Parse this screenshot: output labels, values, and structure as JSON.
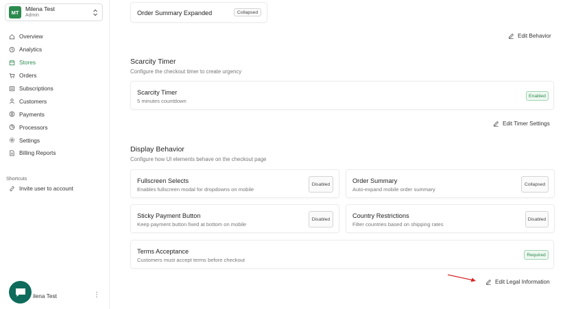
{
  "account": {
    "initials": "MT",
    "name": "Milena Test",
    "role": "Admin"
  },
  "nav": [
    {
      "label": "Overview",
      "icon": "home-icon",
      "active": false
    },
    {
      "label": "Analytics",
      "icon": "clock-icon",
      "active": false
    },
    {
      "label": "Stores",
      "icon": "store-icon",
      "active": true
    },
    {
      "label": "Orders",
      "icon": "cart-icon",
      "active": false
    },
    {
      "label": "Subscriptions",
      "icon": "list-icon",
      "active": false
    },
    {
      "label": "Customers",
      "icon": "user-icon",
      "active": false
    },
    {
      "label": "Payments",
      "icon": "dollar-icon",
      "active": false
    },
    {
      "label": "Processors",
      "icon": "pie-icon",
      "active": false
    },
    {
      "label": "Settings",
      "icon": "gear-icon",
      "active": false
    },
    {
      "label": "Billing Reports",
      "icon": "file-icon",
      "active": false
    }
  ],
  "shortcuts": {
    "title": "Shortcuts",
    "items": [
      {
        "label": "Invite user to account",
        "icon": "link-icon"
      }
    ]
  },
  "footer_user": {
    "name": "ilena Test"
  },
  "order_summary_card": {
    "title": "Order Summary Expanded",
    "badge": "Collapsed"
  },
  "edit_behavior": {
    "label": "Edit Behavior"
  },
  "scarcity": {
    "title": "Scarcity Timer",
    "subtitle": "Configure the checkout timer to create urgency",
    "card_title": "Scarcity Timer",
    "card_sub": "5 minutes countdown",
    "badge": "Enabled",
    "edit_label": "Edit Timer Settings"
  },
  "display": {
    "title": "Display Behavior",
    "subtitle": "Configure how UI elements behave on the checkout page",
    "cards": [
      {
        "title": "Fullscreen Selects",
        "sub": "Enables fullscreen modal for dropdowns on mobile",
        "badge": "Disabled"
      },
      {
        "title": "Order Summary",
        "sub": "Auto-expand mobile order summary",
        "badge": "Collapsed"
      },
      {
        "title": "Sticky Payment Button",
        "sub": "Keep payment button fixed at bottom on mobile",
        "badge": "Disabled"
      },
      {
        "title": "Country Restrictions",
        "sub": "Filter countries based on shipping rates",
        "badge": "Disabled"
      },
      {
        "title": "Terms Acceptance",
        "sub": "Customers must accept terms before checkout",
        "badge": "Required"
      }
    ],
    "edit_label": "Edit Legal Information"
  },
  "colors": {
    "accent": "#2d8a4e",
    "chat": "#0f6b5b",
    "annotation_arrow": "#d62828"
  }
}
